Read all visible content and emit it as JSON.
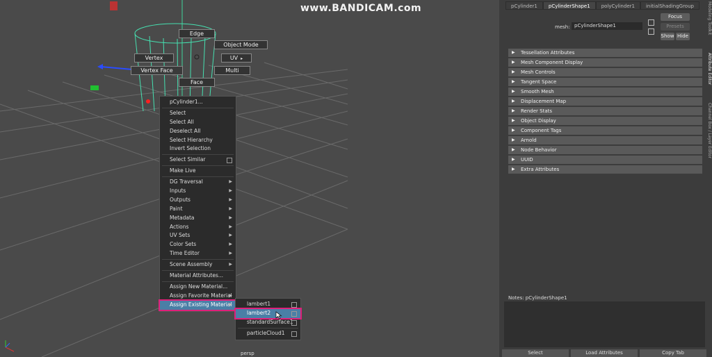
{
  "watermark": "www.BANDICAM.com",
  "camera_label": "persp",
  "hotbox": {
    "edge": "Edge",
    "object_mode": "Object Mode",
    "vertex": "Vertex",
    "uv": "UV",
    "vertex_face": "Vertex Face",
    "multi": "Multi",
    "face": "Face"
  },
  "context_menu": {
    "items": [
      {
        "label": "pCylinder1..."
      },
      {
        "label": "Select"
      },
      {
        "label": "Select All"
      },
      {
        "label": "Deselect All"
      },
      {
        "label": "Select Hierarchy"
      },
      {
        "label": "Invert Selection"
      },
      {
        "label": "Select Similar"
      },
      {
        "label": "Make Live"
      },
      {
        "label": "DG Traversal"
      },
      {
        "label": "Inputs"
      },
      {
        "label": "Outputs"
      },
      {
        "label": "Paint"
      },
      {
        "label": "Metadata"
      },
      {
        "label": "Actions"
      },
      {
        "label": "UV Sets"
      },
      {
        "label": "Color Sets"
      },
      {
        "label": "Time Editor"
      },
      {
        "label": "Scene Assembly"
      },
      {
        "label": "Material Attributes..."
      },
      {
        "label": "Assign New Material..."
      },
      {
        "label": "Assign Favorite Material"
      },
      {
        "label": "Assign Existing Material"
      }
    ],
    "submenu_arrow": "▶"
  },
  "submenu": {
    "items": [
      {
        "label": "lambert1"
      },
      {
        "label": "lambert2"
      },
      {
        "label": "standardSurface1"
      },
      {
        "label": "particleCloud1"
      }
    ]
  },
  "attribute_editor": {
    "tabs": [
      "pCylinder1",
      "pCylinderShape1",
      "polyCylinder1",
      "initialShadingGroup"
    ],
    "mesh_label": "mesh:",
    "mesh_value": "pCylinderShape1",
    "focus": "Focus",
    "presets": "Presets",
    "show": "Show",
    "hide": "Hide",
    "side_tabs": [
      "Modeling Toolkit",
      "Attribute Editor",
      "Channel Box / Layer Editor"
    ],
    "sections": [
      "Tessellation Attributes",
      "Mesh Component Display",
      "Mesh Controls",
      "Tangent Space",
      "Smooth Mesh",
      "Displacement Map",
      "Render Stats",
      "Object Display",
      "Component Tags",
      "Arnold",
      "Node Behavior",
      "UUID",
      "Extra Attributes"
    ],
    "notes_label": "Notes:  pCylinderShape1",
    "bottom_buttons": [
      "Select",
      "Load Attributes",
      "Copy Tab"
    ]
  },
  "colors": {
    "highlight": "#4a7fa6",
    "annotation": "#e0207a",
    "cylinder_wire": "#46e0b0"
  }
}
